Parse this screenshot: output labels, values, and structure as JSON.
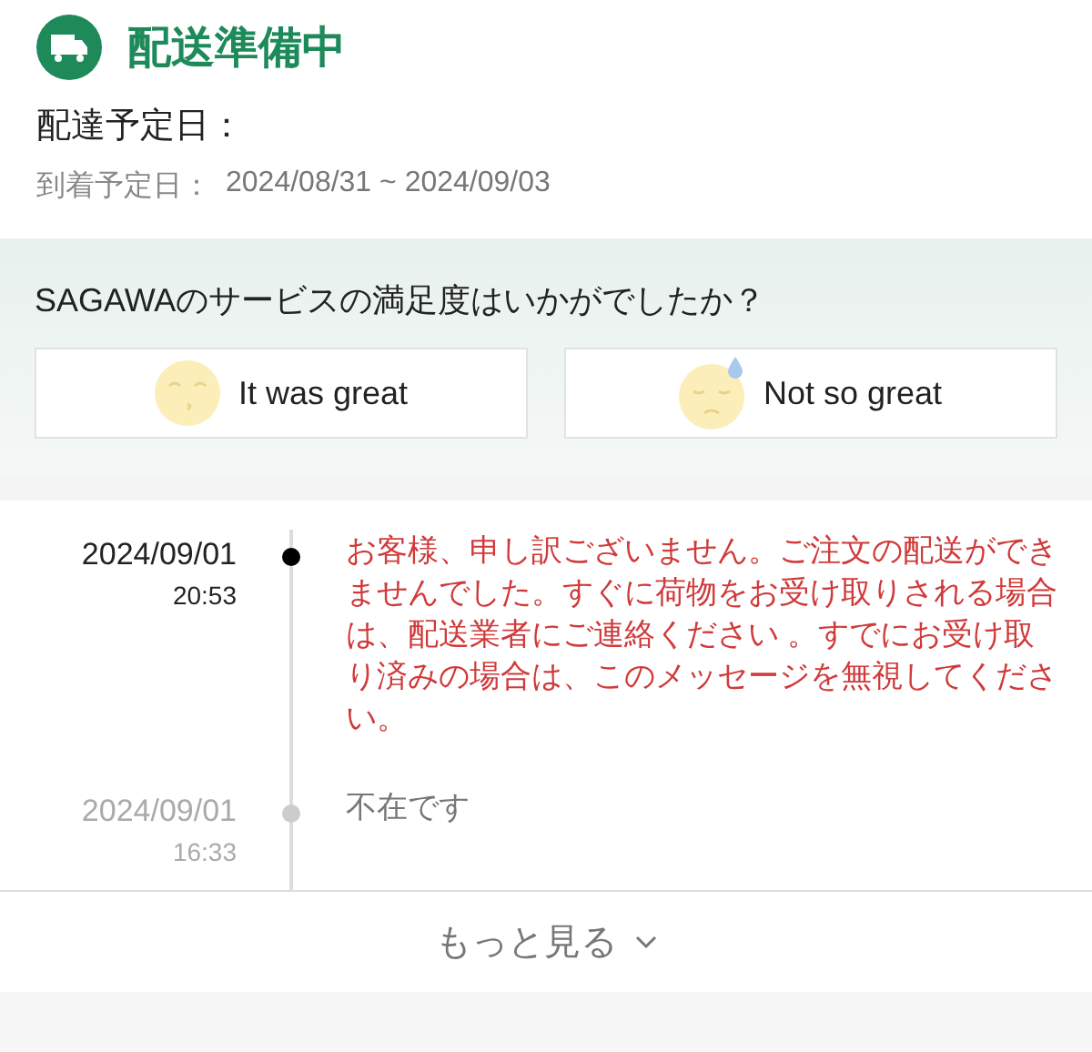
{
  "header": {
    "status": "配送準備中",
    "delivery_label": "配達予定日：",
    "arrival_label": "到着予定日：",
    "arrival_range": "2024/08/31 ~ 2024/09/03"
  },
  "survey": {
    "question": "SAGAWAのサービスの満足度はいかがでしたか？",
    "options": [
      {
        "kind": "happy",
        "label": "It was great"
      },
      {
        "kind": "sad",
        "label": "Not so great"
      }
    ]
  },
  "timeline": [
    {
      "date": "2024/09/01",
      "time": "20:53",
      "message": "お客様、申し訳ございません。ご注文の配送ができませんでした。すぐに荷物をお受け取りされる場合は、配送業者にご連絡ください 。すでにお受け取り済みの場合は、このメッセージを無視してください。",
      "highlighted": true
    },
    {
      "date": "2024/09/01",
      "time": "16:33",
      "message": "不在です",
      "highlighted": false
    }
  ],
  "more_button": {
    "label": "もっと見る"
  }
}
